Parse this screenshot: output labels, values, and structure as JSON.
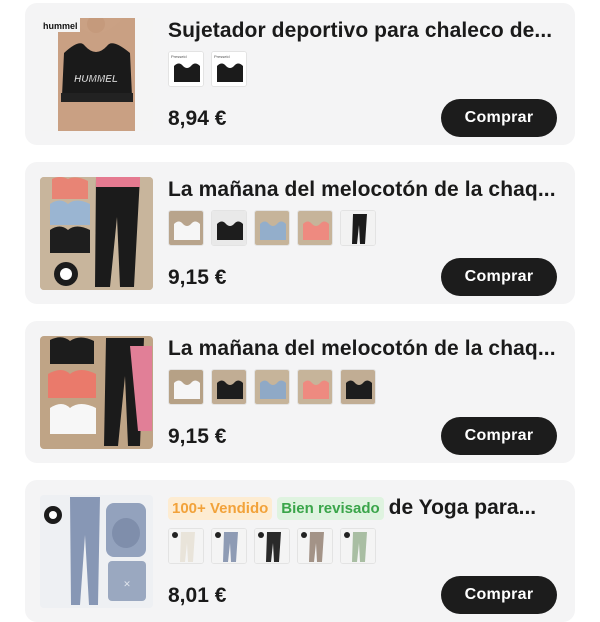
{
  "products": [
    {
      "title": "Sujetador deportivo para chaleco de...",
      "price": "8,94 €",
      "buy_label": "Comprar",
      "brand_text": "hummel",
      "garment_text": "HUMMEL",
      "variant_icons": [
        "black-bra-variant",
        "black-bra-variant"
      ]
    },
    {
      "title": "La mañana del melocotón de la chaq...",
      "price": "9,15 €",
      "buy_label": "Comprar",
      "variant_icons": [
        "white-bra-variant",
        "black-bra-variant",
        "blue-bra-variant",
        "pink-bra-variant",
        "black-leggings-variant"
      ]
    },
    {
      "title": "La mañana del melocotón de la chaq...",
      "price": "9,15 €",
      "buy_label": "Comprar",
      "variant_icons": [
        "white-bra-variant",
        "black-bra-variant",
        "blue-bra-variant",
        "pink-bra-variant",
        "black-bra-variant"
      ]
    },
    {
      "badge_sold": "100+ Vendido",
      "badge_reviewed": "Bien revisado",
      "title_tail": "de Yoga para...",
      "price": "8,01 €",
      "buy_label": "Comprar",
      "variant_icons": [
        "cream-leggings-variant",
        "grey-leggings-variant",
        "black-leggings-variant",
        "taupe-leggings-variant",
        "green-leggings-variant"
      ]
    }
  ],
  "colors": {
    "card_bg": "#f4f4f5",
    "button_bg": "#1c1c1c",
    "sold_badge": "#f2a23a",
    "reviewed_badge": "#3aa54a"
  }
}
